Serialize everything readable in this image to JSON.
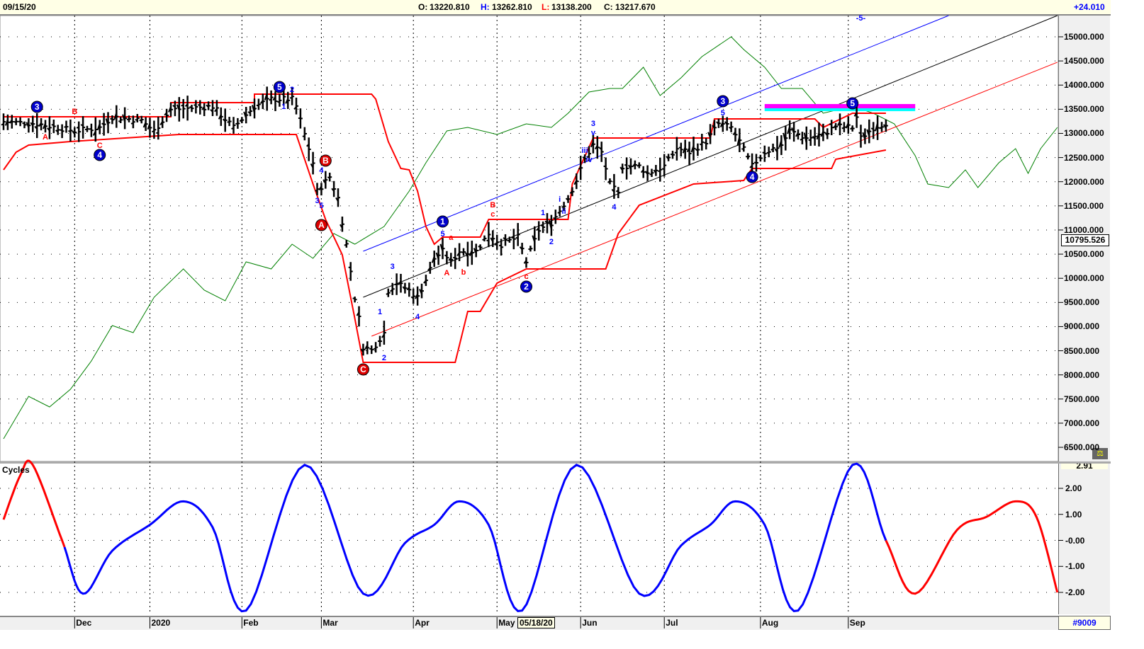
{
  "header": {
    "date": "09/15/20",
    "open_label": "O:",
    "open": "13220.810",
    "high_label": "H:",
    "high": "13262.810",
    "low_label": "L:",
    "low": "13138.200",
    "close_label": "C:",
    "close": "13217.670",
    "change": "+24.010"
  },
  "colors": {
    "up": "#000000",
    "envelope": "#ff0000",
    "green": "#008000",
    "blue_line": "#0000ff",
    "black_line": "#000000",
    "red_line": "#ff0000",
    "magenta": "#ff00ff",
    "cyan": "#00ffff",
    "cycle_blue": "#0000ff",
    "cycle_red": "#ff0000"
  },
  "footer": {
    "symbol_id": "#9009",
    "cursor_date": "05/18/20",
    "current_price_tag": "10795.526",
    "cycle_top_tag": "2.91"
  },
  "chart_data": [
    {
      "type": "line",
      "title": "Price",
      "ylim": [
        6500,
        15400
      ],
      "y_ticks": [
        "15000.000",
        "14500.000",
        "14000.000",
        "13500.000",
        "13000.000",
        "12500.000",
        "12000.000",
        "11500.000",
        "11000.000",
        "10500.000",
        "10000.000",
        "9500.000",
        "9000.000",
        "8500.000",
        "8000.000",
        "7500.000",
        "7000.000",
        "6500.000"
      ],
      "x_ticks": [
        {
          "day": 17,
          "label": "Dec"
        },
        {
          "day": 35,
          "label": "2020"
        },
        {
          "day": 57,
          "label": "Feb"
        },
        {
          "day": 76,
          "label": "Mar"
        },
        {
          "day": 98,
          "label": "Apr"
        },
        {
          "day": 118,
          "label": "May"
        },
        {
          "day": 138,
          "label": "Jun"
        },
        {
          "day": 158,
          "label": "Jul"
        },
        {
          "day": 181,
          "label": "Aug"
        },
        {
          "day": 202,
          "label": "Sep"
        }
      ],
      "closes": [
        [
          0,
          13242
        ],
        [
          8,
          13200
        ],
        [
          17,
          13050
        ],
        [
          23,
          13120
        ],
        [
          26,
          13340
        ],
        [
          33,
          13270
        ],
        [
          36,
          13050
        ],
        [
          40,
          13490
        ],
        [
          50,
          13560
        ],
        [
          55,
          13120
        ],
        [
          60,
          13560
        ],
        [
          64,
          13710
        ],
        [
          69,
          13710
        ],
        [
          70,
          13560
        ],
        [
          72,
          12980
        ],
        [
          74,
          12390
        ],
        [
          75,
          11800
        ],
        [
          78,
          12100
        ],
        [
          80,
          11660
        ],
        [
          82,
          10700
        ],
        [
          84,
          9600
        ],
        [
          85,
          9170
        ],
        [
          86,
          8580
        ],
        [
          88,
          8510
        ],
        [
          91,
          8870
        ],
        [
          92,
          9750
        ],
        [
          94,
          9900
        ],
        [
          97,
          9750
        ],
        [
          99,
          9600
        ],
        [
          101,
          9970
        ],
        [
          103,
          10410
        ],
        [
          105,
          10560
        ],
        [
          107,
          10340
        ],
        [
          109,
          10560
        ],
        [
          113,
          10560
        ],
        [
          116,
          10930
        ],
        [
          119,
          10700
        ],
        [
          123,
          10850
        ],
        [
          125,
          10340
        ],
        [
          128,
          11000
        ],
        [
          131,
          11150
        ],
        [
          135,
          11660
        ],
        [
          137,
          12030
        ],
        [
          139,
          12460
        ],
        [
          141,
          12760
        ],
        [
          143,
          12610
        ],
        [
          145,
          11950
        ],
        [
          147,
          11740
        ],
        [
          148,
          12320
        ],
        [
          152,
          12320
        ],
        [
          154,
          12170
        ],
        [
          158,
          12320
        ],
        [
          161,
          12690
        ],
        [
          164,
          12610
        ],
        [
          168,
          12830
        ],
        [
          171,
          13200
        ],
        [
          174,
          13120
        ],
        [
          176,
          12830
        ],
        [
          179,
          12320
        ],
        [
          182,
          12610
        ],
        [
          186,
          12760
        ],
        [
          188,
          13050
        ],
        [
          192,
          12900
        ],
        [
          196,
          12980
        ],
        [
          199,
          13150
        ],
        [
          203,
          13120
        ],
        [
          204,
          13340
        ],
        [
          205,
          12900
        ],
        [
          208,
          13120
        ],
        [
          211,
          13218
        ]
      ],
      "green_line": [
        [
          0,
          6677
        ],
        [
          6,
          7556
        ],
        [
          11,
          7336
        ],
        [
          16,
          7702
        ],
        [
          21,
          8288
        ],
        [
          26,
          9021
        ],
        [
          31,
          8875
        ],
        [
          36,
          9607
        ],
        [
          43,
          10193
        ],
        [
          48,
          9754
        ],
        [
          53,
          9534
        ],
        [
          58,
          10340
        ],
        [
          64,
          10193
        ],
        [
          69,
          10706
        ],
        [
          74,
          10413
        ],
        [
          79,
          10926
        ],
        [
          84,
          10706
        ],
        [
          91,
          11073
        ],
        [
          97,
          11805
        ],
        [
          101,
          12392
        ],
        [
          106,
          13051
        ],
        [
          111,
          13124
        ],
        [
          118,
          12978
        ],
        [
          125,
          13198
        ],
        [
          131,
          13124
        ],
        [
          135,
          13417
        ],
        [
          140,
          13857
        ],
        [
          145,
          13930
        ],
        [
          148,
          13930
        ],
        [
          153,
          14370
        ],
        [
          157,
          13784
        ],
        [
          162,
          14150
        ],
        [
          167,
          14590
        ],
        [
          174,
          15000
        ],
        [
          177,
          14736
        ],
        [
          182,
          14370
        ],
        [
          186,
          13930
        ],
        [
          191,
          13930
        ],
        [
          196,
          13417
        ],
        [
          203,
          13564
        ],
        [
          208,
          13417
        ],
        [
          213,
          13198
        ],
        [
          218,
          12538
        ],
        [
          221,
          11952
        ],
        [
          226,
          11879
        ],
        [
          230,
          12245
        ],
        [
          233,
          11879
        ],
        [
          238,
          12392
        ],
        [
          242,
          12685
        ],
        [
          245,
          12172
        ],
        [
          248,
          12685
        ],
        [
          252,
          13124
        ]
      ],
      "envelope_upper": [
        [
          0,
          13344
        ],
        [
          40,
          13344
        ],
        [
          40,
          13637
        ],
        [
          60,
          13637
        ],
        [
          60,
          13813
        ],
        [
          88,
          13813
        ],
        [
          89,
          13710
        ],
        [
          92,
          12831
        ],
        [
          95,
          12274
        ],
        [
          97,
          12245
        ],
        [
          99,
          11805
        ],
        [
          101,
          11073
        ],
        [
          103,
          10706
        ],
        [
          105,
          10853
        ],
        [
          114,
          10853
        ],
        [
          116,
          11219
        ],
        [
          135,
          11219
        ],
        [
          136,
          11952
        ],
        [
          141,
          12904
        ],
        [
          169,
          12904
        ],
        [
          170,
          13300
        ],
        [
          194,
          13300
        ],
        [
          196,
          13124
        ],
        [
          203,
          13417
        ],
        [
          211,
          13417
        ]
      ],
      "envelope_lower": [
        [
          0,
          12245
        ],
        [
          3,
          12611
        ],
        [
          6,
          12758
        ],
        [
          16,
          12831
        ],
        [
          42,
          12978
        ],
        [
          70,
          12978
        ],
        [
          74,
          11952
        ],
        [
          77,
          11219
        ],
        [
          81,
          10487
        ],
        [
          84,
          9168
        ],
        [
          86,
          8259
        ],
        [
          108,
          8259
        ],
        [
          111,
          9314
        ],
        [
          114,
          9314
        ],
        [
          118,
          9900
        ],
        [
          125,
          10193
        ],
        [
          144,
          10193
        ],
        [
          147,
          10926
        ],
        [
          152,
          11512
        ],
        [
          165,
          11952
        ],
        [
          177,
          12025
        ],
        [
          179,
          12274
        ],
        [
          198,
          12274
        ],
        [
          199,
          12465
        ],
        [
          211,
          12655
        ]
      ],
      "trendlines": [
        {
          "name": "blue",
          "from": [
            86,
            10560
          ],
          "to": [
            226,
            15440
          ]
        },
        {
          "name": "black",
          "from": [
            86,
            9607
          ],
          "to": [
            252,
            15440
          ]
        },
        {
          "name": "red",
          "from": [
            88,
            8801
          ],
          "to": [
            252,
            14473
          ]
        }
      ],
      "target_zone": {
        "days": [
          182,
          218
        ],
        "magenta_price": 13564,
        "cyan_price": 13490
      },
      "wave_labels": [
        {
          "day": 8,
          "price": 13549,
          "text": "3",
          "color": "blue",
          "circle": true
        },
        {
          "day": 23,
          "price": 12553,
          "text": "4",
          "color": "blue",
          "circle": true
        },
        {
          "day": 66,
          "price": 13960,
          "text": "5",
          "color": "blue",
          "circle": true
        },
        {
          "day": 105,
          "price": 11175,
          "text": "1",
          "color": "blue",
          "circle": true
        },
        {
          "day": 125,
          "price": 9827,
          "text": "2",
          "color": "blue",
          "circle": true
        },
        {
          "day": 172,
          "price": 13667,
          "text": "3",
          "color": "blue",
          "circle": true
        },
        {
          "day": 179,
          "price": 12099,
          "text": "4",
          "color": "blue",
          "circle": true
        },
        {
          "day": 203,
          "price": 13622,
          "text": "5",
          "color": "blue",
          "circle": true
        },
        {
          "day": 77,
          "price": 12436,
          "text": "B",
          "color": "red",
          "circle": true
        },
        {
          "day": 76,
          "price": 11102,
          "text": "A",
          "color": "red",
          "circle": true
        },
        {
          "day": 86,
          "price": 8113,
          "text": "C",
          "color": "red",
          "circle": true
        },
        {
          "day": 205,
          "price": 15396,
          "text": "-5-",
          "color": "blue",
          "circle": false
        },
        {
          "day": 10,
          "price": 12934,
          "text": "A",
          "color": "red",
          "circle": false
        },
        {
          "day": 17,
          "price": 13461,
          "text": "B",
          "color": "red",
          "circle": false
        },
        {
          "day": 23,
          "price": 12758,
          "text": "C",
          "color": "red",
          "circle": false
        },
        {
          "day": 69,
          "price": 13916,
          "text": "2",
          "color": "blue",
          "circle": false
        },
        {
          "day": 67,
          "price": 13564,
          "text": "1",
          "color": "blue",
          "circle": false
        },
        {
          "day": 76,
          "price": 12245,
          "text": "4",
          "color": "blue",
          "circle": false
        },
        {
          "day": 75,
          "price": 11615,
          "text": "3",
          "color": "blue",
          "circle": false
        },
        {
          "day": 76,
          "price": 11512,
          "text": "5",
          "color": "blue",
          "circle": false
        },
        {
          "day": 90,
          "price": 9314,
          "text": "1",
          "color": "blue",
          "circle": false
        },
        {
          "day": 91,
          "price": 8362,
          "text": "2",
          "color": "blue",
          "circle": false
        },
        {
          "day": 93,
          "price": 10252,
          "text": "3",
          "color": "blue",
          "circle": false
        },
        {
          "day": 99,
          "price": 9212,
          "text": "4",
          "color": "blue",
          "circle": false
        },
        {
          "day": 105,
          "price": 10926,
          "text": "5",
          "color": "blue",
          "circle": false
        },
        {
          "day": 107,
          "price": 10853,
          "text": "a",
          "color": "red",
          "circle": false
        },
        {
          "day": 106,
          "price": 10120,
          "text": "A",
          "color": "red",
          "circle": false
        },
        {
          "day": 110,
          "price": 10135,
          "text": "b",
          "color": "red",
          "circle": false
        },
        {
          "day": 117,
          "price": 11527,
          "text": "B",
          "color": "red",
          "circle": false
        },
        {
          "day": 117,
          "price": 11336,
          "text": "c",
          "color": "red",
          "circle": false
        },
        {
          "day": 125,
          "price": 10047,
          "text": "c",
          "color": "red",
          "circle": false
        },
        {
          "day": 129,
          "price": 11366,
          "text": "1",
          "color": "blue",
          "circle": false
        },
        {
          "day": 131,
          "price": 10765,
          "text": "2",
          "color": "blue",
          "circle": false
        },
        {
          "day": 133,
          "price": 11644,
          "text": "i",
          "color": "blue",
          "circle": false
        },
        {
          "day": 134,
          "price": 11395,
          "text": "ii",
          "color": "blue",
          "circle": false
        },
        {
          "day": 141,
          "price": 13212,
          "text": "3",
          "color": "blue",
          "circle": false
        },
        {
          "day": 141,
          "price": 13022,
          "text": "v",
          "color": "blue",
          "circle": false
        },
        {
          "day": 139,
          "price": 12655,
          "text": "iii",
          "color": "blue",
          "circle": false
        },
        {
          "day": 140,
          "price": 12465,
          "text": "iv",
          "color": "blue",
          "circle": false
        },
        {
          "day": 146,
          "price": 11483,
          "text": "4",
          "color": "blue",
          "circle": false
        },
        {
          "day": 172,
          "price": 13432,
          "text": "5",
          "color": "blue",
          "circle": false
        }
      ]
    },
    {
      "type": "line",
      "title": "Cycles",
      "ylim": [
        -2.75,
        3.0
      ],
      "y_ticks": [
        "2.00",
        "1.00",
        "-0.00",
        "-1.00",
        "-2.00"
      ],
      "points": [
        [
          0,
          0.8
        ],
        [
          4,
          2.5
        ],
        [
          7,
          2.9
        ],
        [
          14,
          0.0
        ],
        [
          19,
          -2.05
        ],
        [
          26,
          -0.4
        ],
        [
          35,
          0.6
        ],
        [
          43,
          1.5
        ],
        [
          50,
          0.5
        ],
        [
          58,
          -2.7
        ],
        [
          72,
          2.9
        ],
        [
          86,
          -2.05
        ],
        [
          96,
          -0.1
        ],
        [
          103,
          0.6
        ],
        [
          109,
          1.5
        ],
        [
          116,
          0.6
        ],
        [
          124,
          -2.7
        ],
        [
          137,
          2.9
        ],
        [
          152,
          -2.05
        ],
        [
          162,
          -0.2
        ],
        [
          169,
          0.6
        ],
        [
          175,
          1.5
        ],
        [
          182,
          0.6
        ],
        [
          190,
          -2.7
        ],
        [
          203,
          2.9
        ],
        [
          211,
          0.0
        ],
        [
          218,
          -2.05
        ],
        [
          228,
          0.4
        ],
        [
          235,
          0.9
        ],
        [
          242,
          1.5
        ],
        [
          247,
          0.9
        ],
        [
          252,
          -2.0
        ]
      ],
      "red_ranges": [
        [
          0,
          14
        ],
        [
          211,
          252
        ]
      ]
    }
  ]
}
